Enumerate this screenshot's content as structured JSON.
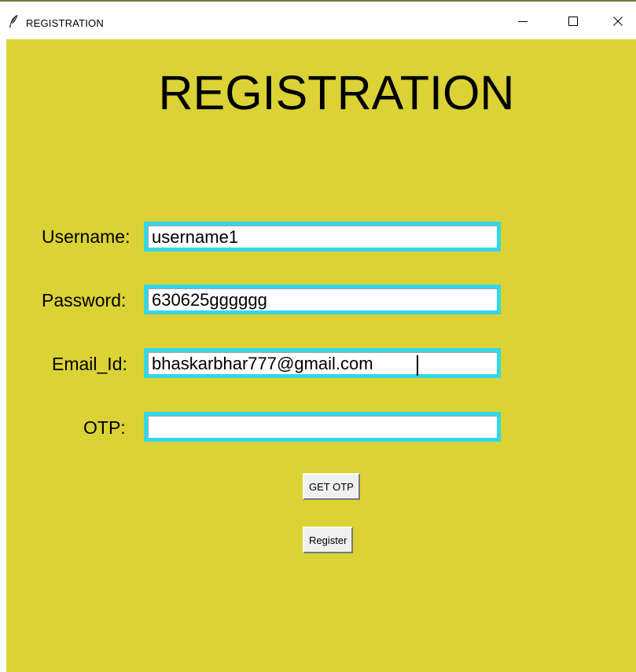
{
  "window": {
    "title": "REGISTRATION",
    "icon": "feather-icon",
    "controls": {
      "minimize_icon": "minimize-icon",
      "maximize_icon": "maximize-icon",
      "close_icon": "close-icon"
    }
  },
  "colors": {
    "background": "#dbd236",
    "field_border": "#34d7ea",
    "field_fill": "#ffffff",
    "button_face": "#f0f0f0"
  },
  "form": {
    "heading": "REGISTRATION",
    "fields": {
      "username": {
        "label": "Username:",
        "value": "username1"
      },
      "password": {
        "label": "Password:",
        "value": "630625gggggg"
      },
      "email": {
        "label": "Email_Id:",
        "value": "bhaskarbhar777@gmail.com"
      },
      "otp": {
        "label": "OTP:",
        "value": ""
      }
    },
    "buttons": {
      "get_otp": "GET OTP",
      "register": "Register"
    }
  }
}
